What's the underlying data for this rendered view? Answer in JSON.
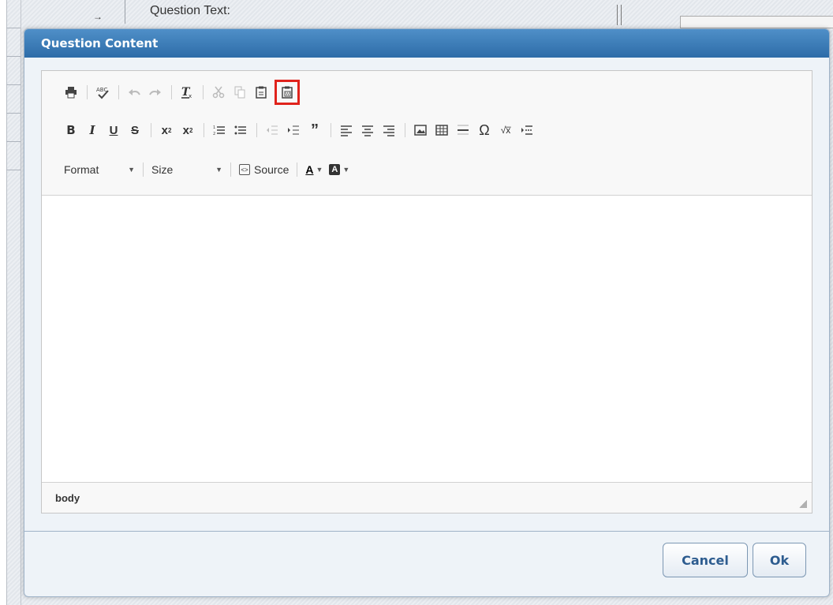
{
  "background": {
    "question_text_label": "Question Text:"
  },
  "dialog": {
    "title": "Question Content",
    "status_path": "body",
    "buttons": {
      "cancel": "Cancel",
      "ok": "Ok"
    }
  },
  "toolbar": {
    "format_label": "Format",
    "size_label": "Size",
    "source_label": "Source",
    "font_color_label": "A",
    "bg_color_label": "A",
    "highlighted_button": "paste-from-word-icon",
    "highlight_color": "#e0231c"
  },
  "colors": {
    "title_bar": "#2d6ca8",
    "button_text": "#2d5c8f"
  }
}
